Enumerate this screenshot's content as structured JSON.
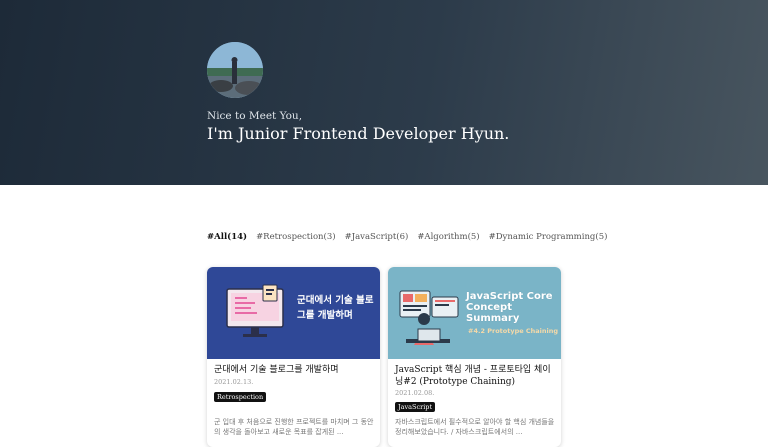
{
  "hero": {
    "subtitle": "Nice to Meet You,",
    "title": "I'm Junior Frontend Developer Hyun."
  },
  "tags": [
    {
      "label": "#All(14)",
      "active": true
    },
    {
      "label": "#Retrospection(3)",
      "active": false
    },
    {
      "label": "#JavaScript(6)",
      "active": false
    },
    {
      "label": "#Algorithm(5)",
      "active": false
    },
    {
      "label": "#Dynamic Programming(5)",
      "active": false
    }
  ],
  "posts": [
    {
      "thumb_text": "군대에서 기술 블로그를 개발하며",
      "title": "군대에서 기술 블로그를 개발하며",
      "date": "2021.02.13.",
      "category": "Retrospection",
      "excerpt": "군 입대 후 처음으로 진행한 프로젝트를 마치며 그 동안의 생각을 돌아보고 새로운 목표를 잡게된 ..."
    },
    {
      "thumb_text": "JavaScript Core Concept Summary",
      "thumb_sub": "#4.2 Prototype Chaining",
      "title": "JavaScript 핵심 개념 - 프로토타입 체이닝#2 (Prototype Chaining)",
      "date": "2021.02.08.",
      "category": "JavaScript",
      "excerpt": "자바스크립트에서 필수적으로 알아야 할 핵심 개념들을 정리해보았습니다. / 자바스크립트에서의 ..."
    }
  ],
  "colors": {
    "hero_start": "#1d2a38",
    "hero_end": "#48555f",
    "thumb1_bg": "#2f4897",
    "thumb2_bg": "#7ab4c7",
    "badge_bg": "#111111"
  }
}
